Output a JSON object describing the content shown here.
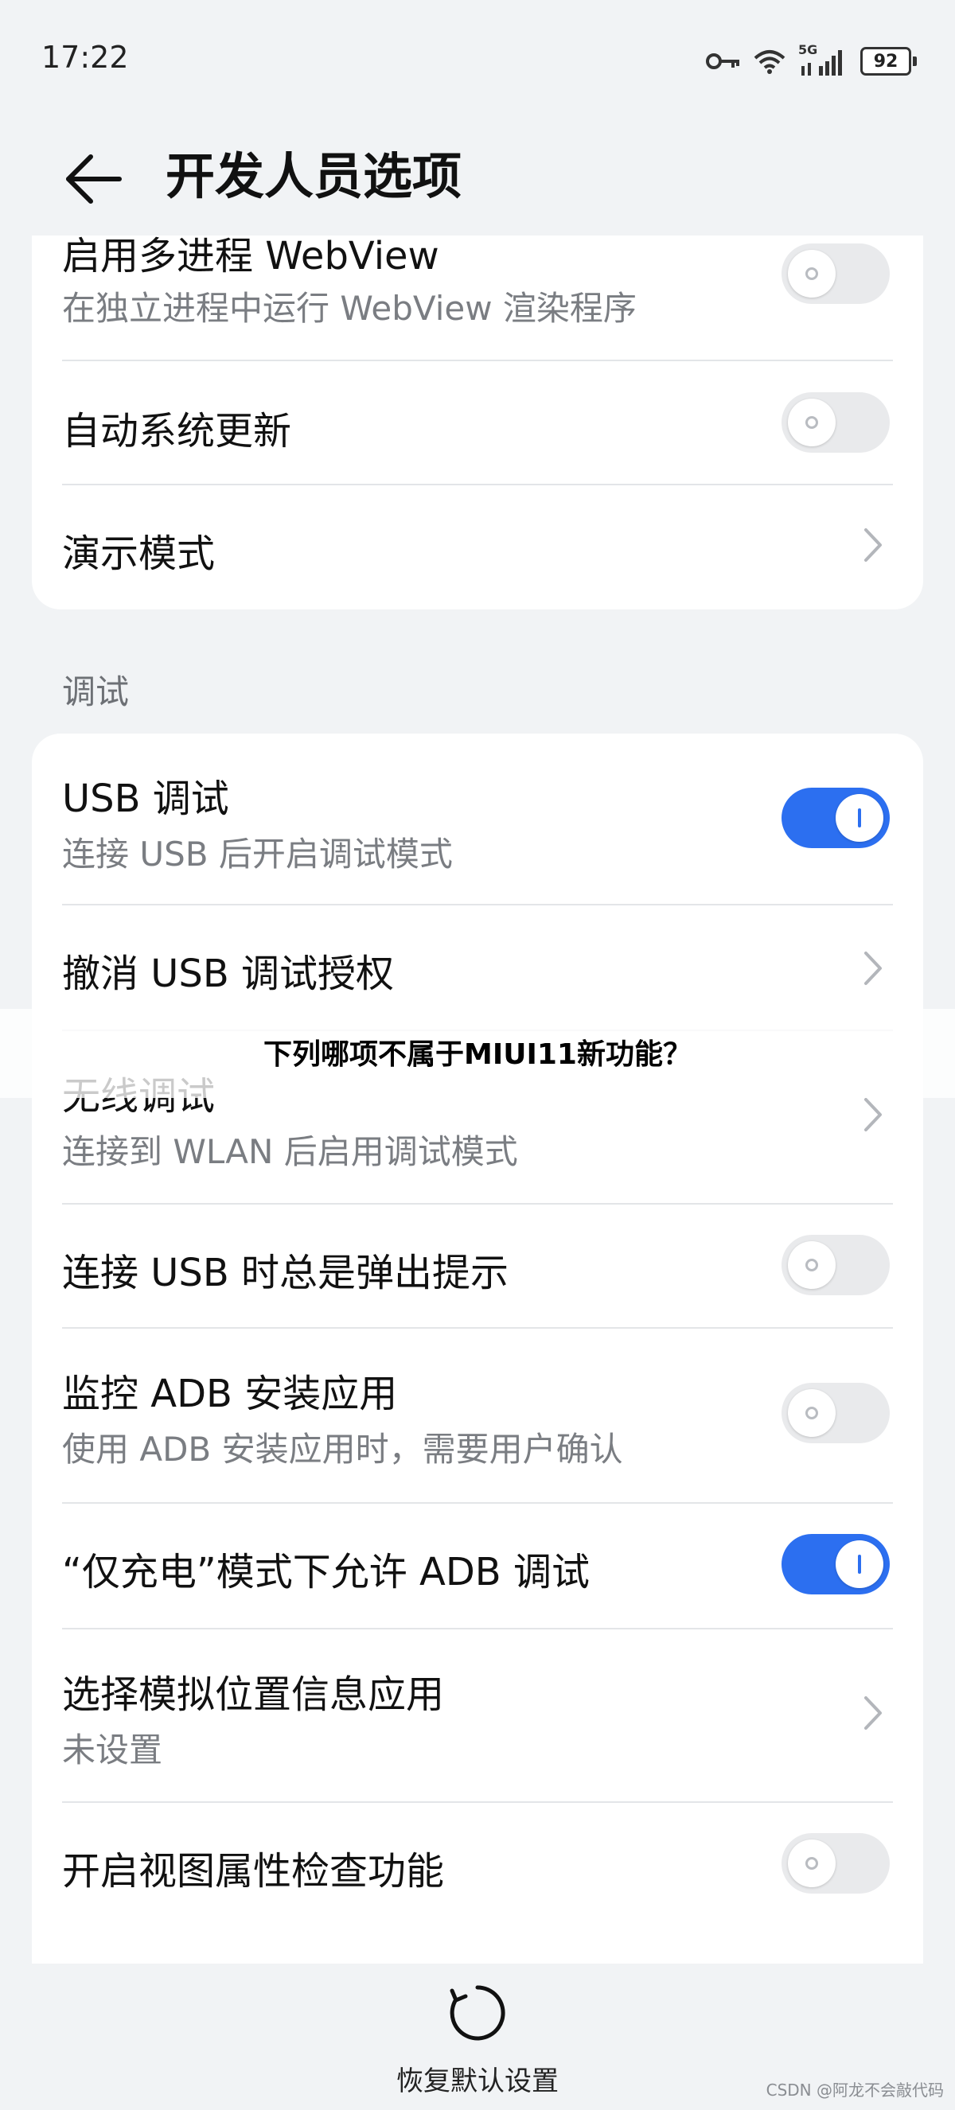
{
  "status_bar": {
    "time": "17:22",
    "network": "5G",
    "battery": "92"
  },
  "header": {
    "title": "开发人员选项"
  },
  "card_top": {
    "rows": [
      {
        "title": "启用多进程 WebView",
        "subtitle": "在独立进程中运行 WebView 渲染程序",
        "toggle": "off"
      },
      {
        "title": "自动系统更新",
        "toggle": "off"
      },
      {
        "title": "演示模式",
        "chevron": true
      }
    ]
  },
  "section_debug": {
    "label": "调试"
  },
  "card_debug": {
    "rows": [
      {
        "title": "USB 调试",
        "subtitle": "连接 USB 后开启调试模式",
        "toggle": "on"
      },
      {
        "title": "撤消 USB 调试授权",
        "chevron": true
      },
      {
        "title": "无线调试",
        "subtitle": "连接到 WLAN 后启用调试模式",
        "chevron": true
      },
      {
        "title": "连接 USB 时总是弹出提示",
        "toggle": "off"
      },
      {
        "title": "监控 ADB 安装应用",
        "subtitle": "使用 ADB 安装应用时，需要用户确认",
        "toggle": "off"
      },
      {
        "title": "“仅充电”模式下允许 ADB 调试",
        "toggle": "on"
      },
      {
        "title": "选择模拟位置信息应用",
        "subtitle": "未设置",
        "chevron": true
      },
      {
        "title": "开启视图属性检查功能",
        "toggle": "off"
      }
    ]
  },
  "overlay": {
    "text": "下列哪项不属于MIUI11新功能？"
  },
  "bottom": {
    "reset_label": "恢复默认设置"
  },
  "watermark": "CSDN @阿龙不会敲代码",
  "colors": {
    "accent": "#2c6ff0",
    "background": "#f1f3f5",
    "card": "#ffffff"
  }
}
